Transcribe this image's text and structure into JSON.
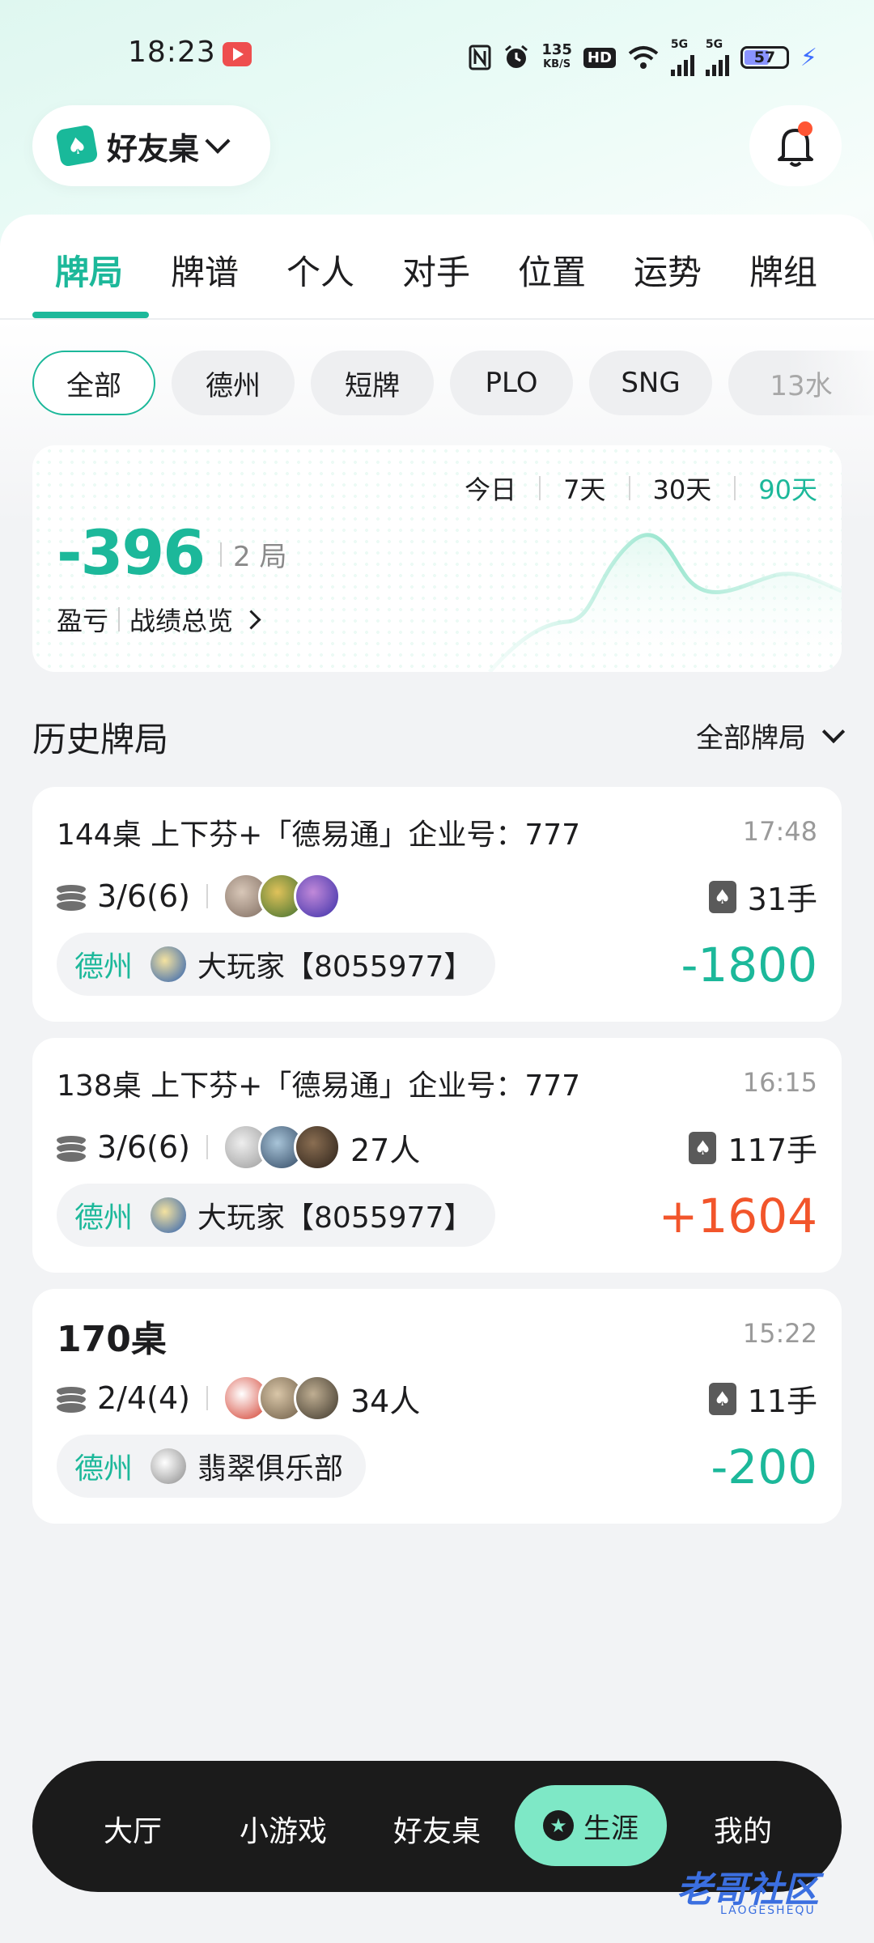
{
  "status_bar": {
    "time": "18:23",
    "speed": "135",
    "speed_unit": "KB/S",
    "hd": "HD",
    "network1": "5G",
    "network2": "5G",
    "battery": "57",
    "icons": [
      "youtube-icon",
      "nfc-icon",
      "alarm-icon",
      "wifi-icon",
      "signal-icon",
      "battery-icon",
      "charging-icon"
    ]
  },
  "header": {
    "club_name": "好友桌",
    "icons": [
      "club-logo-icon",
      "chevron-down-icon",
      "bell-icon"
    ]
  },
  "tabs": [
    {
      "label": "牌局",
      "active": true
    },
    {
      "label": "牌谱"
    },
    {
      "label": "个人"
    },
    {
      "label": "对手"
    },
    {
      "label": "位置"
    },
    {
      "label": "运势"
    },
    {
      "label": "牌组"
    }
  ],
  "filters": [
    {
      "label": "全部",
      "active": true
    },
    {
      "label": "德州"
    },
    {
      "label": "短牌"
    },
    {
      "label": "PLO"
    },
    {
      "label": "SNG"
    },
    {
      "label": "13水"
    }
  ],
  "summary": {
    "ranges": [
      "今日",
      "7天",
      "30天",
      "90天"
    ],
    "active_range": "90天",
    "profit": "-396",
    "games": "2 局",
    "label": "盈亏",
    "overview_link": "战绩总览",
    "accent_color": "#1cb89a"
  },
  "history": {
    "title": "历史牌局",
    "filter_label": "全部牌局",
    "games": [
      {
        "title": "144桌 上下芬+「德易通」企业号：777",
        "time": "17:48",
        "blinds": "3/6(6)",
        "players": "",
        "hands": "31手",
        "type": "德州",
        "club": "大玩家【8055977】",
        "amount": "-1800",
        "positive": false
      },
      {
        "title": "138桌 上下芬+「德易通」企业号：777",
        "time": "16:15",
        "blinds": "3/6(6)",
        "players": "27人",
        "hands": "117手",
        "type": "德州",
        "club": "大玩家【8055977】",
        "amount": "+1604",
        "positive": true
      },
      {
        "title": "170桌",
        "time": "15:22",
        "blinds": "2/4(4)",
        "players": "34人",
        "hands": "11手",
        "type": "德州",
        "club": "翡翠俱乐部",
        "amount": "-200",
        "positive": false
      }
    ]
  },
  "bottom_nav": {
    "items": [
      "大厅",
      "小游戏",
      "好友桌",
      "生涯",
      "我的"
    ],
    "active": "生涯"
  },
  "watermark": {
    "text": "老哥社区",
    "sub": "LAOGESHEQU"
  }
}
